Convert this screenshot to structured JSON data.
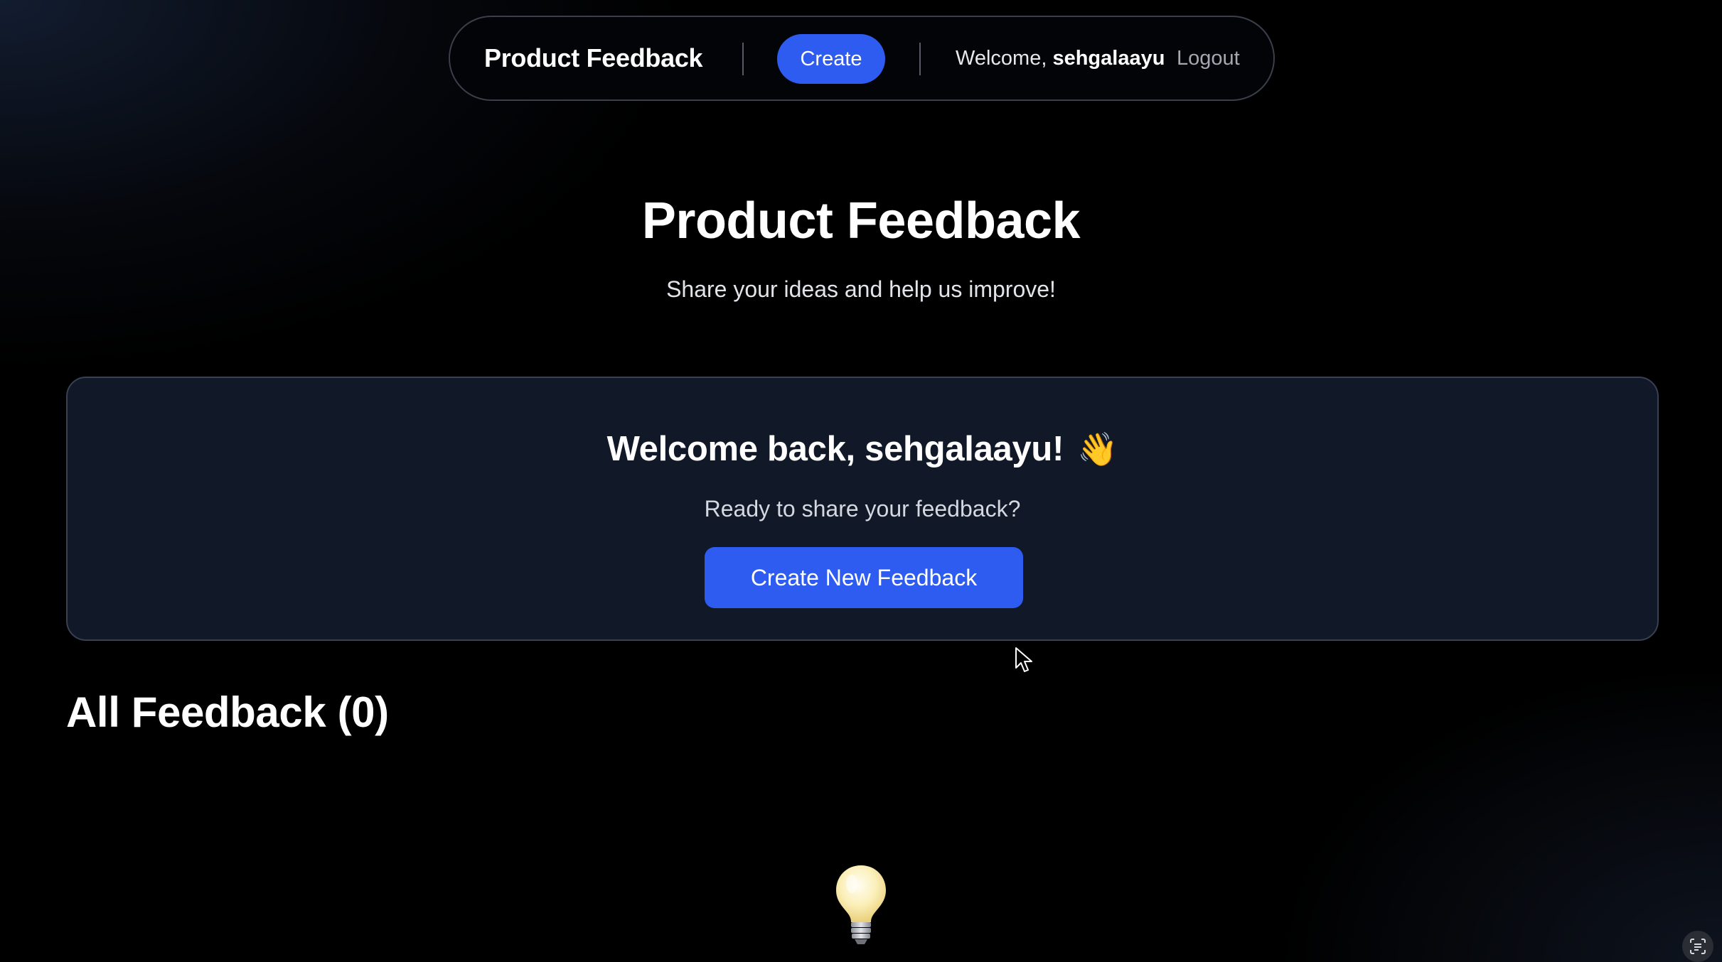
{
  "nav": {
    "brand": "Product Feedback",
    "create_label": "Create",
    "welcome_prefix": "Welcome, ",
    "username": "sehgalaayu",
    "logout_label": "Logout"
  },
  "hero": {
    "title": "Product Feedback",
    "subtitle": "Share your ideas and help us improve!"
  },
  "welcome_card": {
    "heading": "Welcome back, sehgalaayu!",
    "wave_emoji": "👋",
    "subtitle": "Ready to share your feedback?",
    "button_label": "Create New Feedback"
  },
  "feedback_list": {
    "heading": "All Feedback (0)",
    "empty_icon": "lightbulb-icon"
  },
  "colors": {
    "accent": "#2f5cf0",
    "card_background": "#111827",
    "page_background": "#000000"
  }
}
